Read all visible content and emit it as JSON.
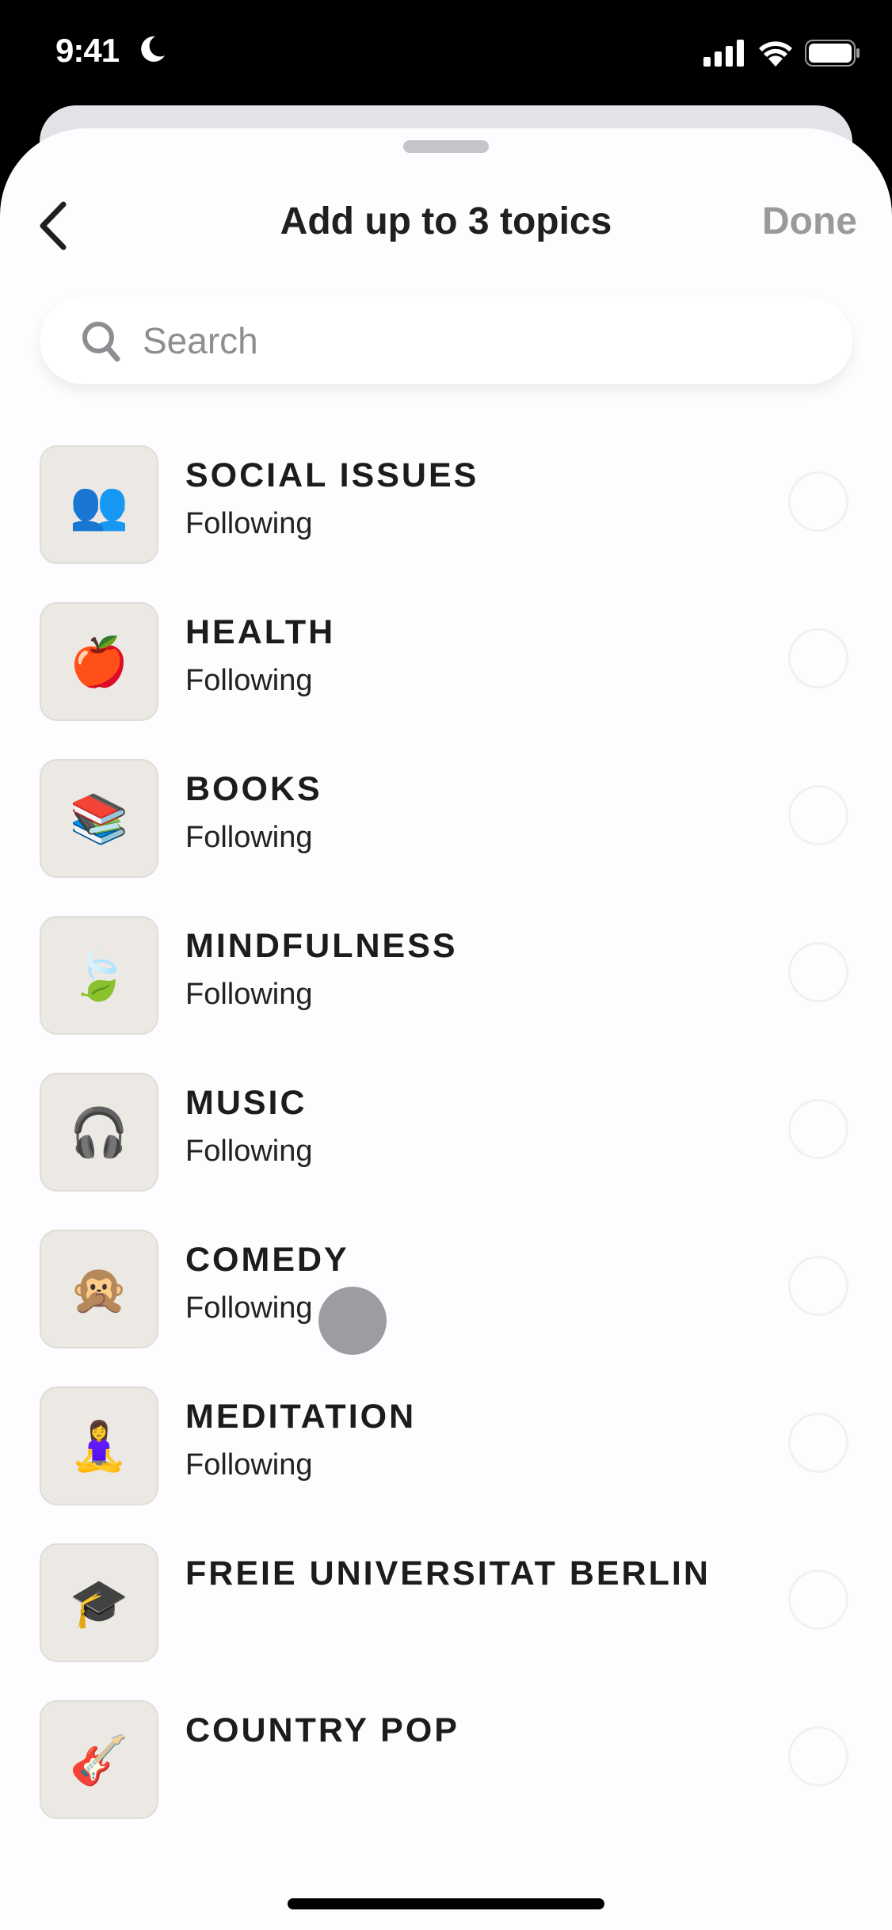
{
  "status_bar": {
    "time": "9:41",
    "icons": [
      "moon-icon",
      "signal-icon",
      "wifi-icon",
      "battery-icon"
    ]
  },
  "header": {
    "title": "Add up to 3 topics",
    "done_label": "Done",
    "back_icon": "chevron-left-icon"
  },
  "search": {
    "placeholder": "Search",
    "value": ""
  },
  "topics": [
    {
      "name": "SOCIAL ISSUES",
      "status": "Following",
      "icon": "👥",
      "icon_name": "people-icon",
      "selected": false
    },
    {
      "name": "HEALTH",
      "status": "Following",
      "icon": "🍎",
      "icon_name": "apple-icon",
      "selected": false
    },
    {
      "name": "BOOKS",
      "status": "Following",
      "icon": "📚",
      "icon_name": "books-icon",
      "selected": false
    },
    {
      "name": "MINDFULNESS",
      "status": "Following",
      "icon": "🍃",
      "icon_name": "leaf-icon",
      "selected": false
    },
    {
      "name": "MUSIC",
      "status": "Following",
      "icon": "🎧",
      "icon_name": "headphones-icon",
      "selected": false
    },
    {
      "name": "COMEDY",
      "status": "Following",
      "icon": "🙊",
      "icon_name": "monkey-icon",
      "selected": false
    },
    {
      "name": "MEDITATION",
      "status": "Following",
      "icon": "🧘‍♀️",
      "icon_name": "meditation-icon",
      "selected": false
    },
    {
      "name": "FREIE UNIVERSITAT BERLIN",
      "status": "",
      "icon": "🎓",
      "icon_name": "graduation-cap-icon",
      "selected": false
    },
    {
      "name": "COUNTRY POP",
      "status": "",
      "icon": "🎸",
      "icon_name": "guitar-icon",
      "selected": false
    }
  ]
}
